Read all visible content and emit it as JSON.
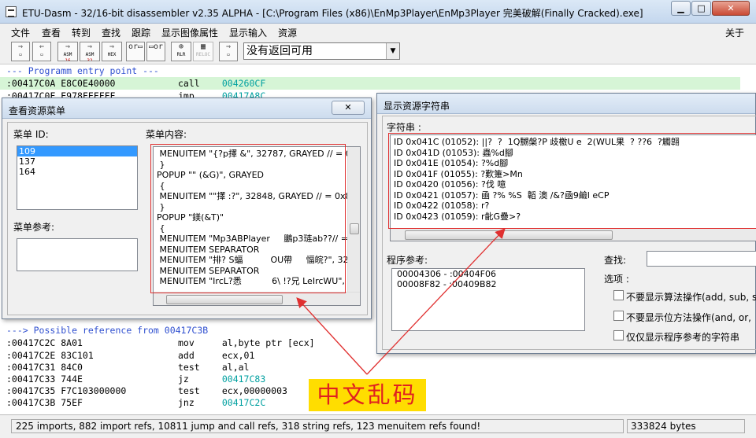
{
  "window": {
    "title": "ETU-Dasm - 32/16-bit disassembler v2.35 ALPHA - [C:\\Program Files (x86)\\EnMp3Player\\EnMp3Player 完美破解(Finally Cracked).exe]",
    "min": "▁",
    "max": "□",
    "close": "✕"
  },
  "menu": {
    "items": [
      "文件",
      "查看",
      "转到",
      "查找",
      "跟踪",
      "显示图像属性",
      "显示输入",
      "资源"
    ],
    "about": "关于"
  },
  "toolbar": {
    "combo_value": "没有返回可用",
    "combo_arrow": "▼",
    "btn_asm": "ASM",
    "btn_16": "16",
    "btn_32": "32",
    "btn_hex": "HEX",
    "btn_reloc": "RELOC",
    "btn_rlr": "RLR"
  },
  "code_lines": [
    {
      "text": "--- Programm entry point ---",
      "kind": "comment"
    },
    {
      "addr": ":00417C0A E8C0E40000",
      "mn": "call",
      "op": "004260CF",
      "target": true,
      "highlight": true
    },
    {
      "addr": ":00417C0F E978FEFFFF",
      "mn": "jmp",
      "op": "00417A8C",
      "target": true
    },
    {
      "text": "---> Possible reference from 00417C3B",
      "kind": "comment"
    },
    {
      "addr": ":00417C2C 8A01",
      "mn": "mov",
      "op": "al,byte ptr [ecx]"
    },
    {
      "addr": ":00417C2E 83C101",
      "mn": "add",
      "op": "ecx,01"
    },
    {
      "addr": ":00417C31 84C0",
      "mn": "test",
      "op": "al,al"
    },
    {
      "addr": ":00417C33 744E",
      "mn": "jz",
      "op": "00417C83",
      "target": true
    },
    {
      "addr": ":00417C35 F7C103000000",
      "mn": "test",
      "op": "ecx,00000003"
    },
    {
      "addr": ":00417C3B 75EF",
      "mn": "jnz",
      "op": "00417C2C",
      "target": true
    }
  ],
  "menu_dialog": {
    "title": "查看资源菜单",
    "close": "✕",
    "menu_id_label": "菜单 ID:",
    "menu_ids": [
      "109",
      "137",
      "164"
    ],
    "selected_id": "109",
    "menu_content_label": "菜单内容:",
    "menu_refs_label": "菜单参考:",
    "menu_content": [
      " MENUITEM \"{?p擇 &\", 32787, GRAYED // = 0x8",
      " }",
      "POPUP \"\" (&G)\", GRAYED",
      " {",
      " MENUITEM \"\"擇 :?\", 32848, GRAYED // = 0x80",
      " }",
      "POPUP \"鎂(&T)\"",
      " {",
      " MENUITEM \"Mp3ABPlayer     鵬p3琏ab??// = 0x8",
      " MENUITEM SEPARATOR",
      " MENUITEM \"排? S蝠          OU帶     愊皖?\", 32",
      " MENUITEM SEPARATOR",
      " MENUITEM \"IrcL?悉           6\\ !?兄 LeIrcWU\", 3"
    ]
  },
  "string_dialog": {
    "title": "显示资源字符串",
    "strings_label": "字符串 :",
    "strings": [
      "ID 0x041C (01052): ||?  ?  1Q嬲槃?P 歧檄U e  2(WUL果  ? ??6  ?觸翶",
      "ID 0x041D (01053): 蟲%d腳",
      "ID 0x041E (01054): ?%d腳",
      "ID 0x041F (01055): ?歎箑>Mn",
      "ID 0x0420 (01056): ?伐 噫",
      "ID 0x0421 (01057): 凾 ?% %S  韜 澳 /&?凾9鹼l eCP",
      "ID 0x0422 (01058): r?",
      "ID 0x0423 (01059): r齔G疊>?"
    ],
    "refs_label": "程序参考:",
    "refs": [
      "00004306 - :00404F06",
      "00008F82 - :00409B82"
    ],
    "find_label": "查找:",
    "options_label": "选项 :",
    "options": [
      "不要显示算法操作(add, sub, s",
      "不要显示位方法操作(and, or,",
      "仅仅显示程序参考的字符串"
    ]
  },
  "status": {
    "left": "225 imports, 882 import refs, 10811 jump and call refs, 318 string refs, 123 menuitem refs found!",
    "right": "333824 bytes"
  },
  "annotation": "中文乱码",
  "colors": {
    "annotation_bg": "#ffdd00",
    "annotation_fg": "#e02020",
    "red_box": "#e03030",
    "comment": "#3050d0",
    "target": "#00a0a0",
    "highlight": "#d6f5d6",
    "selection": "#3399ff"
  }
}
